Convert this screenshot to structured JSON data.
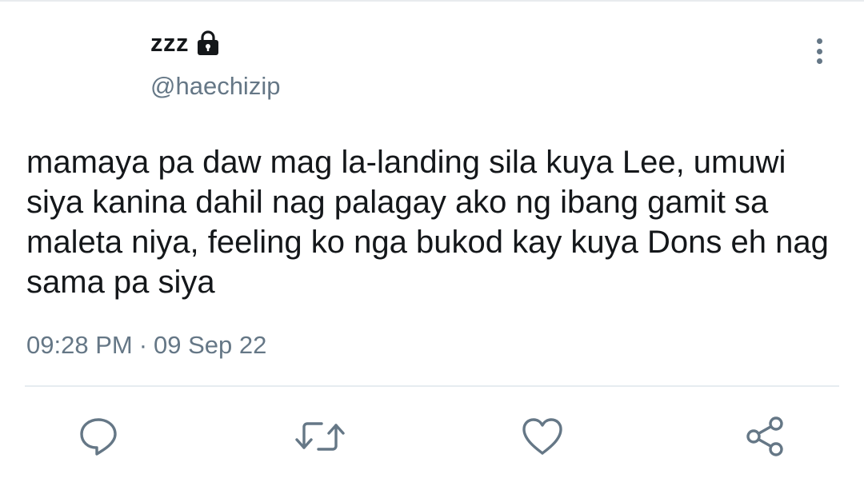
{
  "tweet": {
    "display_name": "zzz",
    "handle": "@haechizip",
    "text": "mamaya pa daw mag la-landing sila kuya Lee, umuwi siya kanina dahil nag palagay ako ng ibang gamit sa maleta niya, feeling ko nga bukod kay kuya Dons eh nag sama pa siya",
    "time": "09:28 PM",
    "separator": "·",
    "date": "09 Sep 22",
    "protected": true
  },
  "icons": {
    "lock": "lock-icon",
    "more": "more-vertical-icon",
    "reply": "reply-icon",
    "retweet": "retweet-icon",
    "like": "heart-icon",
    "share": "share-icon"
  },
  "colors": {
    "text": "#14171a",
    "secondary": "#657786",
    "divider": "#e6ecf0"
  }
}
